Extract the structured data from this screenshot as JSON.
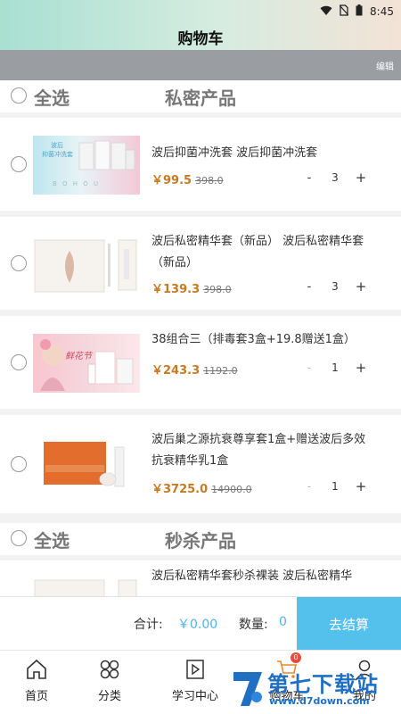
{
  "status_bar": {
    "time": "8:45"
  },
  "header": {
    "title": "购物车",
    "edit_label": "编辑"
  },
  "sections": [
    {
      "select_all": "全选",
      "title": "私密产品"
    },
    {
      "select_all": "全选",
      "title": "秒杀产品"
    }
  ],
  "items": [
    {
      "name": "波后抑菌冲洗套 波后抑菌冲洗套",
      "price": "￥99.5",
      "old_price": "398.0",
      "qty": "3",
      "minus": "-",
      "plus": "+"
    },
    {
      "name": "波后私密精华套（新品） 波后私密精华套（新品）",
      "price": "￥139.3",
      "old_price": "398.0",
      "qty": "3",
      "minus": "-",
      "plus": "+"
    },
    {
      "name": "38组合三（排毒套3盒+19.8赠送1盒）",
      "price": "￥243.3",
      "old_price": "1192.0",
      "qty": "1",
      "minus": "-",
      "plus": "+"
    },
    {
      "name": "波后巢之源抗衰尊享套1盒+赠送波后多效抗衰精华乳1盒",
      "price": "￥3725.0",
      "old_price": "14900.0",
      "qty": "1",
      "minus": "-",
      "plus": "+"
    },
    {
      "name": "波后私密精华套秒杀裸装 波后私密精华"
    }
  ],
  "thumb_text": {
    "item1_line1": "波后",
    "item1_line2": "抑菌冲洗套",
    "item1_brand": "B O H O U",
    "item3_text": "鲜花节"
  },
  "checkout": {
    "total_label": "合计:",
    "total_value": "￥0.00",
    "qty_label": "数量:",
    "qty_value": "0",
    "button": "去结算"
  },
  "tabs": [
    {
      "label": "首页",
      "icon": "home-icon"
    },
    {
      "label": "分类",
      "icon": "category-icon"
    },
    {
      "label": "学习中心",
      "icon": "play-video-icon"
    },
    {
      "label": "购物车",
      "icon": "cart-icon"
    },
    {
      "label": "我的",
      "icon": "user-icon"
    }
  ],
  "cart_badge": "0",
  "watermark": {
    "main": "第七下载站",
    "sub": "www.d7down.com"
  },
  "colors": {
    "accent": "#54c0ec",
    "price": "#c77a22",
    "header_bg": "#a8e0d2",
    "sub_bar": "#9a9ea3",
    "badge": "#e94a3b"
  }
}
